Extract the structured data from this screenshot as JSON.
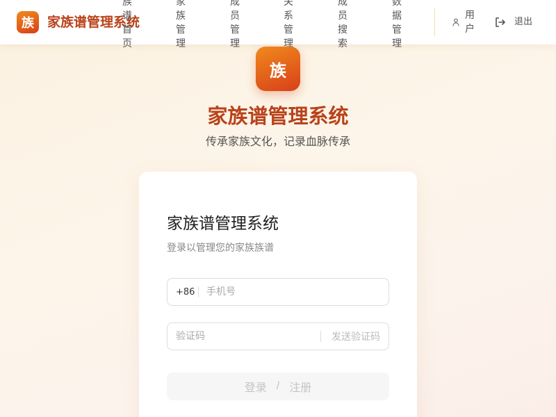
{
  "header": {
    "logo_char": "族",
    "brand": "家族谱管理系统",
    "nav": [
      "族谱首页",
      "家族管理",
      "成员管理",
      "关系管理",
      "成员搜索",
      "数据管理"
    ],
    "user_label": "用户",
    "logout_label": "退出"
  },
  "hero": {
    "logo_char": "族",
    "title": "家族谱管理系统",
    "subtitle": "传承家族文化，记录血脉传承"
  },
  "login_card": {
    "title": "家族谱管理系统",
    "subtitle": "登录以管理您的家族族谱",
    "phone_prefix": "+86",
    "phone_placeholder": "手机号",
    "phone_value": "",
    "code_placeholder": "验证码",
    "code_value": "",
    "send_code_label": "发送验证码",
    "login_label": "登录",
    "login_separator": "/",
    "register_label": "注册"
  },
  "colors": {
    "brand": "#b8421a",
    "logo_gradient_start": "#f08a1c",
    "logo_gradient_end": "#d8401a",
    "divider": "#f2dfa8"
  },
  "icons": {
    "user": "user-icon",
    "logout": "logout-icon"
  }
}
